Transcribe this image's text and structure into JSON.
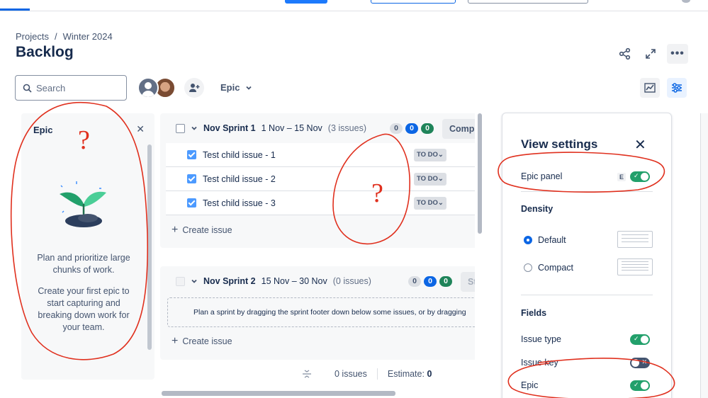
{
  "breadcrumb": {
    "project": "Projects",
    "separator": "/",
    "current": "Winter 2024"
  },
  "page": {
    "title": "Backlog"
  },
  "header": {
    "share_icon": "share-icon",
    "expand_icon": "expand-icon",
    "more_label": "•••"
  },
  "toolbar": {
    "search_placeholder": "Search",
    "epic_filter": "Epic"
  },
  "epic_panel": {
    "title": "Epic",
    "message_1": "Plan and prioritize large chunks of work.",
    "message_2": "Create your first epic to start capturing and breaking down work for your team."
  },
  "sprints": [
    {
      "name": "Nov Sprint 1",
      "dates": "1 Nov – 15 Nov",
      "count": "(3 issues)",
      "badges": [
        "0",
        "0",
        "0"
      ],
      "action": "Compl",
      "issues": [
        {
          "title": "Test child issue - 1",
          "status": "TO DO"
        },
        {
          "title": "Test child issue - 2",
          "status": "TO DO"
        },
        {
          "title": "Test child issue - 3",
          "status": "TO DO"
        }
      ],
      "create_label": "Create issue"
    },
    {
      "name": "Nov Sprint 2",
      "dates": "15 Nov – 30 Nov",
      "count": "(0 issues)",
      "badges": [
        "0",
        "0",
        "0"
      ],
      "action": "St",
      "empty_message": "Plan a sprint by dragging the sprint footer down below some issues, or by dragging",
      "create_label": "Create issue"
    }
  ],
  "backlog_footer": {
    "issues": "0 issues",
    "estimate_label": "Estimate:",
    "estimate_value": "0"
  },
  "view_settings": {
    "title": "View settings",
    "epic_panel_label": "Epic panel",
    "epic_panel_shortcut": "E",
    "epic_panel_enabled": true,
    "density_heading": "Density",
    "density_options": [
      "Default",
      "Compact"
    ],
    "density_selected": "Default",
    "fields_heading": "Fields",
    "fields": [
      {
        "label": "Issue type",
        "enabled": true
      },
      {
        "label": "Issue key",
        "enabled": false
      },
      {
        "label": "Epic",
        "enabled": true
      }
    ]
  },
  "annotations": {
    "question_mark": "?"
  },
  "colors": {
    "accent": "#0c66e4",
    "toggle_on": "#22a06b",
    "annotation": "#e0301e"
  }
}
